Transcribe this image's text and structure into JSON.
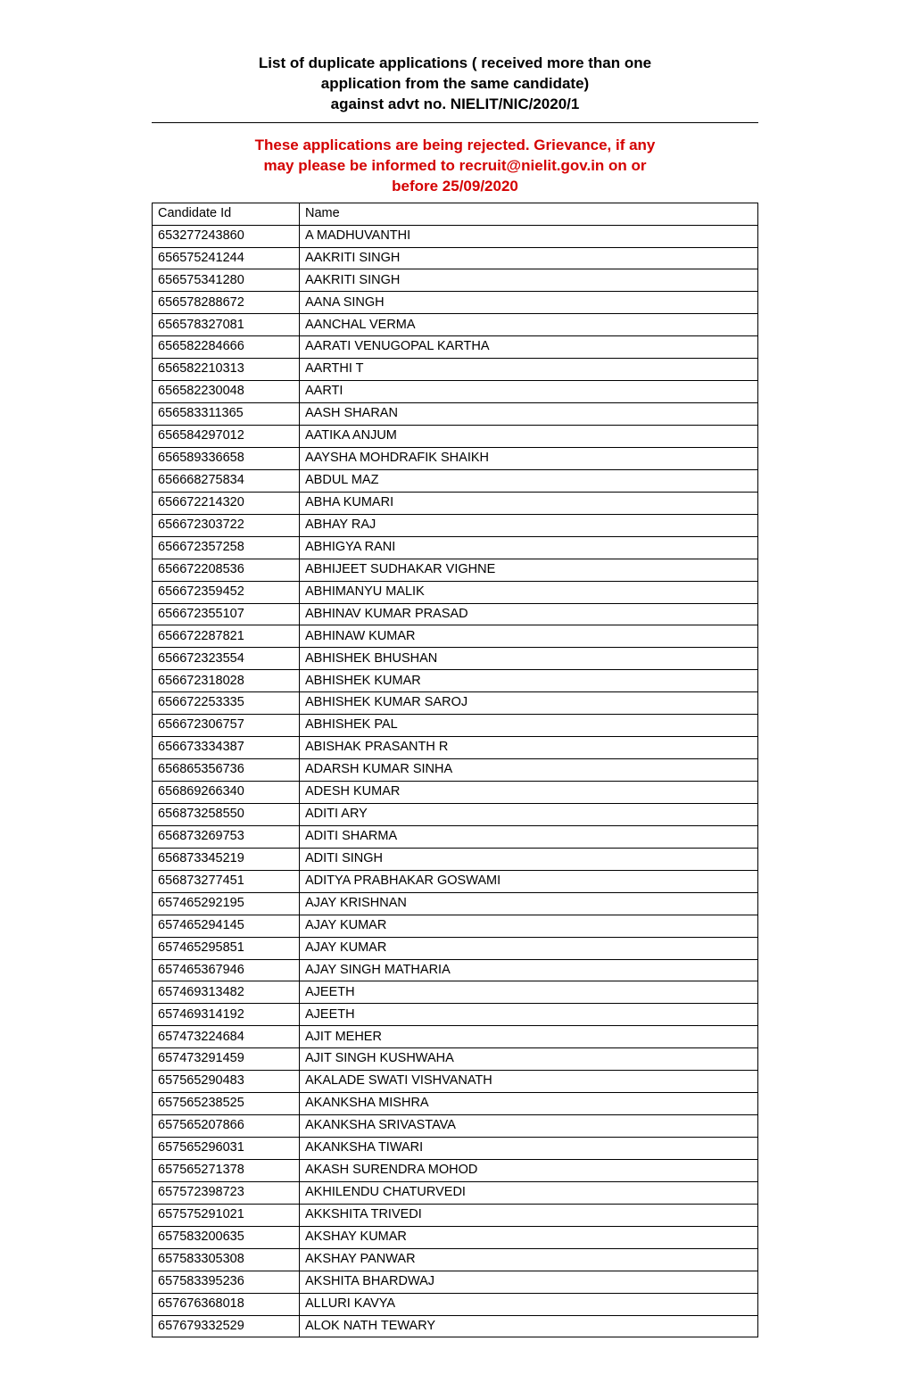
{
  "title": {
    "line1": "List of duplicate applications ( received more than one",
    "line2": "application from the same candidate)",
    "line3": "against advt no. NIELIT/NIC/2020/1"
  },
  "notice": {
    "line1": "These applications are being rejected. Grievance, if any",
    "line2": "may please be informed to recruit@nielit.gov.in on or",
    "line3": "before 25/09/2020"
  },
  "table": {
    "headers": {
      "col1": "Candidate Id",
      "col2": "Name"
    },
    "rows": [
      {
        "id": "653277243860",
        "name": "A MADHUVANTHI"
      },
      {
        "id": "656575241244",
        "name": "AAKRITI SINGH"
      },
      {
        "id": "656575341280",
        "name": "AAKRITI SINGH"
      },
      {
        "id": "656578288672",
        "name": "AANA SINGH"
      },
      {
        "id": "656578327081",
        "name": "AANCHAL VERMA"
      },
      {
        "id": "656582284666",
        "name": "AARATI VENUGOPAL KARTHA"
      },
      {
        "id": "656582210313",
        "name": "AARTHI T"
      },
      {
        "id": "656582230048",
        "name": "AARTI"
      },
      {
        "id": "656583311365",
        "name": "AASH SHARAN"
      },
      {
        "id": "656584297012",
        "name": "AATIKA ANJUM"
      },
      {
        "id": "656589336658",
        "name": "AAYSHA MOHDRAFIK SHAIKH"
      },
      {
        "id": "656668275834",
        "name": "ABDUL MAZ"
      },
      {
        "id": "656672214320",
        "name": "ABHA KUMARI"
      },
      {
        "id": "656672303722",
        "name": "ABHAY RAJ"
      },
      {
        "id": "656672357258",
        "name": "ABHIGYA RANI"
      },
      {
        "id": "656672208536",
        "name": "ABHIJEET SUDHAKAR VIGHNE"
      },
      {
        "id": "656672359452",
        "name": "ABHIMANYU MALIK"
      },
      {
        "id": "656672355107",
        "name": "ABHINAV KUMAR PRASAD"
      },
      {
        "id": "656672287821",
        "name": "ABHINAW KUMAR"
      },
      {
        "id": "656672323554",
        "name": "ABHISHEK BHUSHAN"
      },
      {
        "id": "656672318028",
        "name": "ABHISHEK KUMAR"
      },
      {
        "id": "656672253335",
        "name": "ABHISHEK KUMAR SAROJ"
      },
      {
        "id": "656672306757",
        "name": "ABHISHEK PAL"
      },
      {
        "id": "656673334387",
        "name": "ABISHAK PRASANTH R"
      },
      {
        "id": "656865356736",
        "name": "ADARSH KUMAR SINHA"
      },
      {
        "id": "656869266340",
        "name": "ADESH KUMAR"
      },
      {
        "id": "656873258550",
        "name": "ADITI ARY"
      },
      {
        "id": "656873269753",
        "name": "ADITI SHARMA"
      },
      {
        "id": "656873345219",
        "name": "ADITI SINGH"
      },
      {
        "id": "656873277451",
        "name": "ADITYA PRABHAKAR GOSWAMI"
      },
      {
        "id": "657465292195",
        "name": "AJAY KRISHNAN"
      },
      {
        "id": "657465294145",
        "name": "AJAY KUMAR"
      },
      {
        "id": "657465295851",
        "name": "AJAY KUMAR"
      },
      {
        "id": "657465367946",
        "name": "AJAY SINGH MATHARIA"
      },
      {
        "id": "657469313482",
        "name": "AJEETH"
      },
      {
        "id": "657469314192",
        "name": "AJEETH"
      },
      {
        "id": "657473224684",
        "name": "AJIT MEHER"
      },
      {
        "id": "657473291459",
        "name": "AJIT SINGH KUSHWAHA"
      },
      {
        "id": "657565290483",
        "name": "AKALADE SWATI VISHVANATH"
      },
      {
        "id": "657565238525",
        "name": "AKANKSHA MISHRA"
      },
      {
        "id": "657565207866",
        "name": "AKANKSHA SRIVASTAVA"
      },
      {
        "id": "657565296031",
        "name": "AKANKSHA TIWARI"
      },
      {
        "id": "657565271378",
        "name": "AKASH SURENDRA MOHOD"
      },
      {
        "id": "657572398723",
        "name": "AKHILENDU CHATURVEDI"
      },
      {
        "id": "657575291021",
        "name": "AKKSHITA TRIVEDI"
      },
      {
        "id": "657583200635",
        "name": "AKSHAY KUMAR"
      },
      {
        "id": "657583305308",
        "name": "AKSHAY PANWAR"
      },
      {
        "id": "657583395236",
        "name": "AKSHITA BHARDWAJ"
      },
      {
        "id": "657676368018",
        "name": "ALLURI KAVYA"
      },
      {
        "id": "657679332529",
        "name": "ALOK NATH TEWARY"
      }
    ]
  }
}
